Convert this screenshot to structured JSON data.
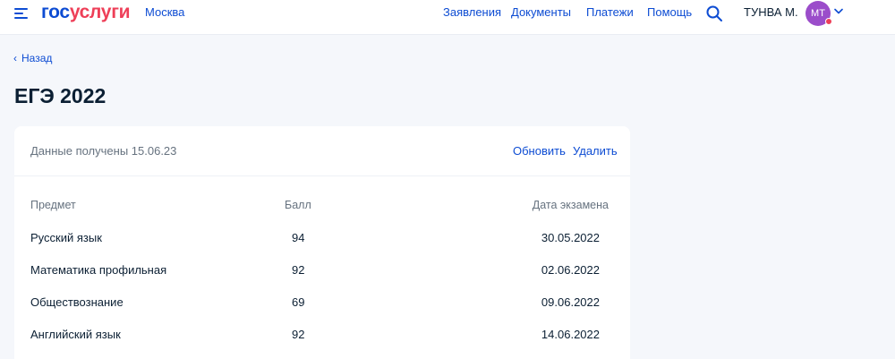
{
  "header": {
    "logo_part1": "гос",
    "logo_part2": "услуги",
    "city": "Москва",
    "nav": [
      "Заявления",
      "Документы",
      "Платежи",
      "Помощь"
    ],
    "user_name": "ТУНВА М.",
    "avatar_initials": "МТ"
  },
  "page": {
    "back_label": "Назад",
    "title": "ЕГЭ 2022"
  },
  "card": {
    "received": "Данные получены 15.06.23",
    "refresh_label": "Обновить",
    "delete_label": "Удалить",
    "columns": [
      "Предмет",
      "Балл",
      "Дата экзамена"
    ],
    "rows": [
      {
        "subject": "Русский язык",
        "score": "94",
        "date": "30.05.2022"
      },
      {
        "subject": "Математика профильная",
        "score": "92",
        "date": "02.06.2022"
      },
      {
        "subject": "Обществознание",
        "score": "69",
        "date": "09.06.2022"
      },
      {
        "subject": "Английский язык",
        "score": "92",
        "date": "14.06.2022"
      }
    ]
  },
  "colors": {
    "brand_blue": "#0d4cd3",
    "brand_red": "#ee3f58",
    "avatar": "#9b4dca"
  }
}
